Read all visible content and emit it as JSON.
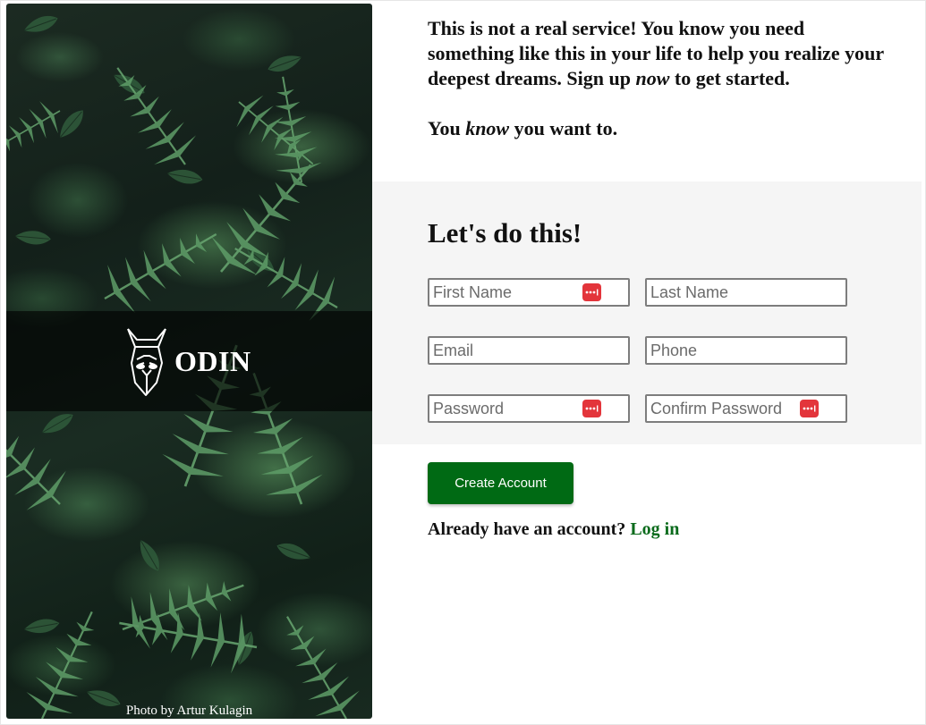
{
  "sidebar": {
    "logo_text": "ODIN",
    "photo_credit": "Photo by Artur Kulagin"
  },
  "intro": {
    "paragraph1_before": "This is not a real service! You know you need something like this in your life to help you realize your deepest dreams. Sign up ",
    "paragraph1_emphasis": "now",
    "paragraph1_after": " to get started.",
    "paragraph2_before": "You ",
    "paragraph2_emphasis": "know",
    "paragraph2_after": " you want to."
  },
  "form": {
    "title": "Let's do this!",
    "first_name_placeholder": "First Name",
    "last_name_placeholder": "Last Name",
    "email_placeholder": "Email",
    "phone_placeholder": "Phone",
    "password_placeholder": "Password",
    "confirm_password_placeholder": "Confirm Password",
    "password_manager_icon": "password-key-icon",
    "submit_label": "Create Account"
  },
  "login": {
    "prompt": "Already have an account?",
    "link_label": "Log in"
  },
  "colors": {
    "button_bg": "#006a14",
    "link": "#0b6b1c",
    "form_bg": "#f5f5f5",
    "password_icon_bg": "#e3353b"
  }
}
